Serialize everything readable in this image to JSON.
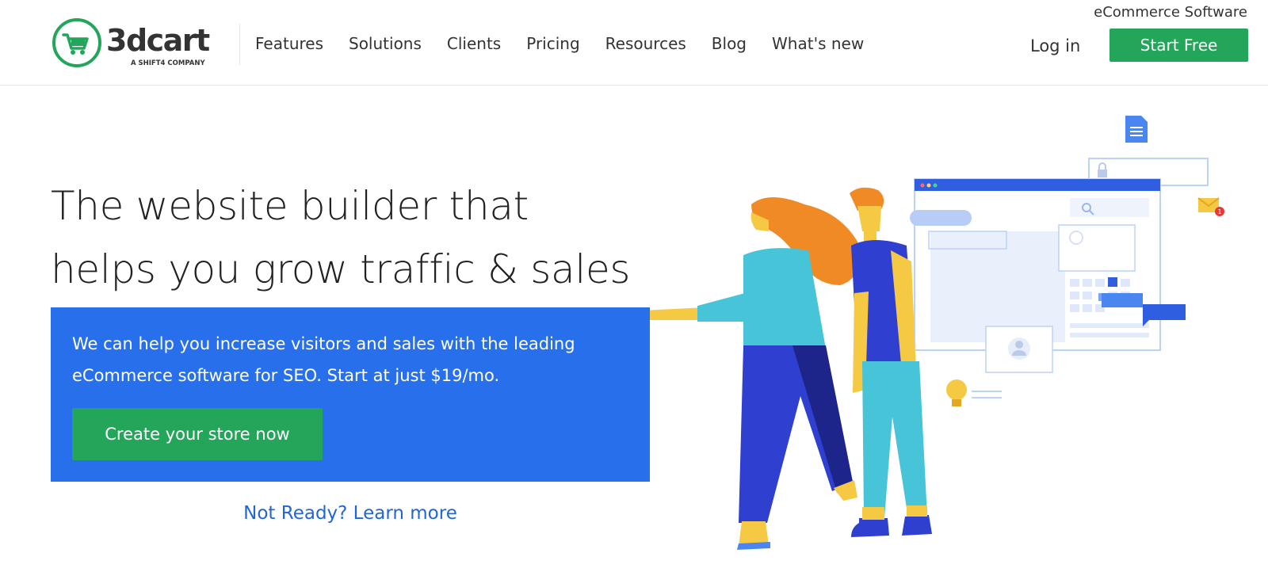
{
  "brand": {
    "name": "3dcart",
    "tagline": "A SHIFT4 COMPANY",
    "green": "#23a55a"
  },
  "header": {
    "top_tagline": "eCommerce Software",
    "nav": [
      {
        "label": "Features"
      },
      {
        "label": "Solutions"
      },
      {
        "label": "Clients"
      },
      {
        "label": "Pricing"
      },
      {
        "label": "Resources"
      },
      {
        "label": "Blog"
      },
      {
        "label": "What's new"
      }
    ],
    "login_label": "Log in",
    "start_free_label": "Start Free"
  },
  "hero": {
    "headline_line1": "The website builder that",
    "headline_line2": "helps you grow traffic & sales",
    "description": "We can help you increase visitors and sales with the leading eCommerce software for SEO. Start at just $19/mo.",
    "cta_label": "Create your store now",
    "learn_more_label": "Not Ready? Learn more",
    "accent_blue": "#2870eb"
  },
  "illustration": {
    "notification_badge": "1"
  }
}
